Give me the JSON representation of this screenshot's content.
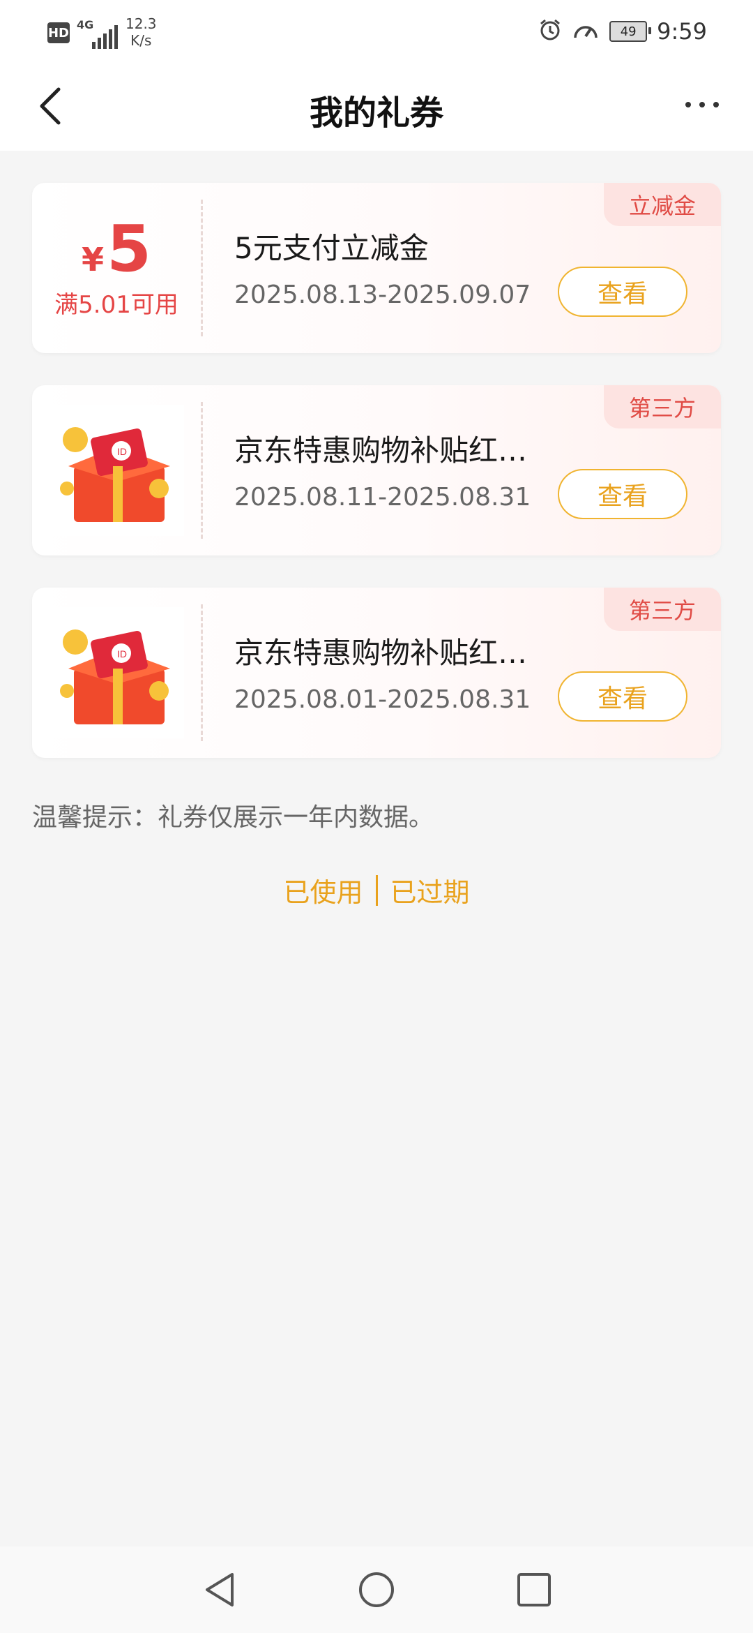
{
  "status_bar": {
    "hd": "HD",
    "network": "4G",
    "speed_value": "12.3",
    "speed_unit": "K/s",
    "battery": "49",
    "time": "9:59"
  },
  "header": {
    "title": "我的礼券"
  },
  "coupons": [
    {
      "tag": "立减金",
      "currency": "¥",
      "amount": "5",
      "min_spend": "满5.01可用",
      "title": "5元支付立减金",
      "date": "2025.08.13-2025.09.07",
      "button": "查看"
    },
    {
      "tag": "第三方",
      "title": "京东特惠购物补贴红…",
      "date": "2025.08.11-2025.08.31",
      "button": "查看"
    },
    {
      "tag": "第三方",
      "title": "京东特惠购物补贴红…",
      "date": "2025.08.01-2025.08.31",
      "button": "查看"
    }
  ],
  "tips": "温馨提示：礼券仅展示一年内数据。",
  "links": {
    "used": "已使用",
    "expired": "已过期"
  },
  "colors": {
    "accent": "#e9a21d",
    "red": "#e54545",
    "tag_bg": "#fde3e1"
  }
}
